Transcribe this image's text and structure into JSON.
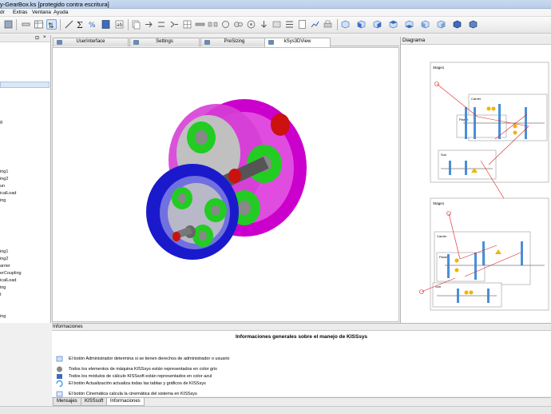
{
  "window": {
    "title": "y-GearBox.ks [protegido contra escritura]"
  },
  "menu": [
    "dr",
    "Extras",
    "Ventana",
    "Ayuda"
  ],
  "left_panel": {
    "tree_items": [
      "g",
      "ing1",
      "ing2",
      "un",
      "icalLoad",
      "ing",
      "ing1",
      "ing2",
      "arrier",
      "erCoupling",
      "icalLoad",
      "ing",
      "t",
      "ing"
    ]
  },
  "tabs": [
    "UserInterface",
    "Settings",
    "PreSizing",
    "kSys3DView"
  ],
  "active_tab": "kSys3DView",
  "diagram": {
    "header": "Diagrama",
    "labels": [
      "Stage1",
      "Carrier",
      "Planet",
      "Sun",
      "Stage1",
      "Carrier",
      "Planet",
      "Sun"
    ]
  },
  "info": {
    "header": "Informaciones",
    "title": "Informaciones generales sobre el manejo de KISSsys",
    "lines": [
      "El botón Administrador determina si se tienen derechos de administrador o usuario",
      "Todos los elementos de máquina KISSsys están representados en color gris",
      "Todos los módulos de cálculo KISSsoft están representados en color azul",
      "El botón Actualización actualiza todas las tablas y gráficos de KISSsys",
      "El botón Cinemática calcula la cinemática del sistema en KISSsys"
    ]
  },
  "bottom_tabs": [
    "Mensajes",
    "KISSsoft",
    "Informaciones"
  ],
  "active_bottom_tab": "Informaciones",
  "colors": {
    "ring_gear": "#cc00cc",
    "ring_gear_front": "#1a1acc",
    "planet": "#22cc22",
    "sun": "#888888",
    "shaft": "#cc1111",
    "diagram_line": "#dd2222"
  }
}
